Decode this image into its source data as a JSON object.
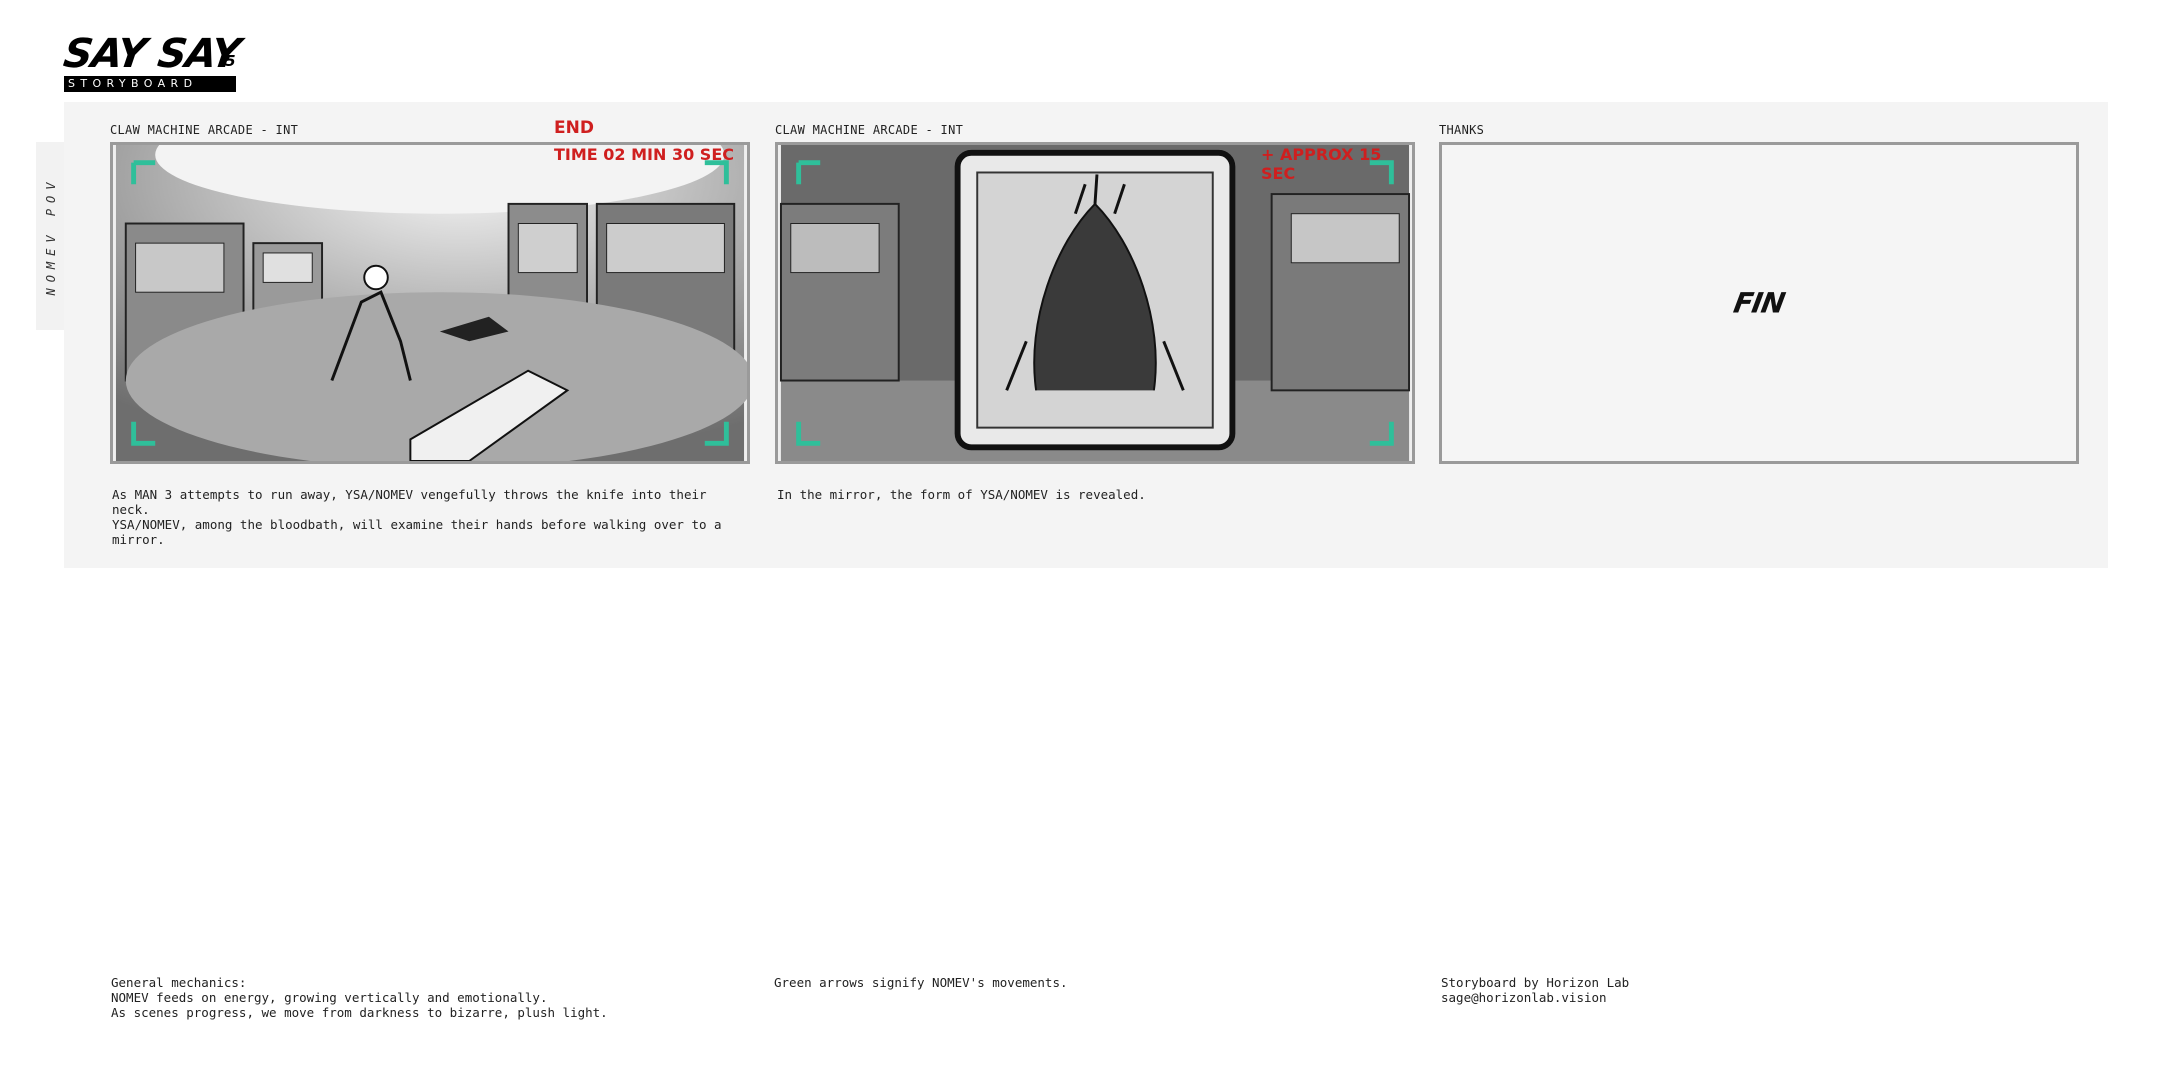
{
  "logo": {
    "main": "SAY SAY",
    "superscript": "i5",
    "sub": "STORYBOARD"
  },
  "side_tab": "NOMEV POV",
  "panels": [
    {
      "scene": "CLAW MACHINE ARCADE - INT",
      "overlay_top": "END",
      "overlay_time": "TIME 02 MIN 30 SEC",
      "caption": "As MAN 3 attempts to run away, YSA/NOMEV vengefully throws the knife into their neck.\nYSA/NOMEV, among the bloodbath, will examine their hands before walking over to a\nmirror."
    },
    {
      "scene": "CLAW MACHINE ARCADE - INT",
      "overlay_time": "+ APPROX 15 SEC",
      "caption": "In the mirror, the form of YSA/NOMEV is revealed."
    },
    {
      "scene": "THANKS",
      "center_text": "FIN",
      "caption": ""
    }
  ],
  "footer": {
    "col1": "General mechanics:\nNOMEV feeds on energy, growing vertically and emotionally.\nAs scenes progress, we move from darkness to bizarre, plush light.",
    "col2": "Green arrows signify NOMEV's movements.",
    "col3": "Storyboard by Horizon Lab\nsage@horizonlab.vision"
  },
  "colors": {
    "accent_green": "#2fbf9a",
    "time_red": "#cf1f1f",
    "board_bg": "#f4f4f4"
  }
}
